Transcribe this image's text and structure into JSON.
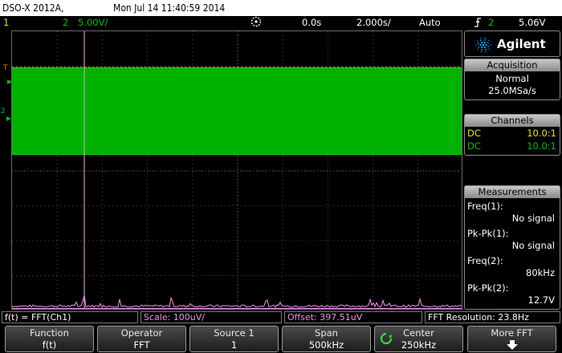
{
  "title_bar": {
    "model": "DSO-X 2012A,",
    "datetime": "Mon Jul 14 11:40:59 2014"
  },
  "status_row": {
    "ch1_num": "1",
    "ch2_num": "2",
    "ch2_scale": "5.00V/",
    "time_delay": "0.0s",
    "time_base": "2.000s/",
    "trigger_mode": "Auto",
    "trigger_channel": "2",
    "trigger_level": "5.06V"
  },
  "colors": {
    "ch1": "#e4e400",
    "ch2": "#00c000",
    "fft": "#f090f0",
    "accent": "#00b0ff"
  },
  "brand": {
    "name": "Agilent"
  },
  "acquisition": {
    "title": "Acquisition",
    "mode": "Normal",
    "rate": "25.0MSa/s"
  },
  "channels": {
    "title": "Channels",
    "rows": [
      {
        "coupling": "DC",
        "probe": "10.0:1",
        "color": "#e4e400"
      },
      {
        "coupling": "DC",
        "probe": "10.0:1",
        "color": "#00c000"
      }
    ]
  },
  "measurements": {
    "title": "Measurements",
    "items": [
      {
        "label": "Freq(1):",
        "value": "No signal",
        "color": "#e4e400"
      },
      {
        "label": "Pk-Pk(1):",
        "value": "No signal",
        "color": "#e4e400"
      },
      {
        "label": "Freq(2):",
        "value": "80kHz",
        "color": "#00c000"
      },
      {
        "label": "Pk-Pk(2):",
        "value": "12.7V",
        "color": "#00c000"
      }
    ]
  },
  "info_strip": {
    "function": "f(t) = FFT(Ch1)",
    "scale": "Scale: 100uV/",
    "offset": "Offset: 397.51uV",
    "resolution": "FFT Resolution: 23.8Hz"
  },
  "softkeys": [
    {
      "line1": "Function",
      "line2": "f(t)"
    },
    {
      "line1": "Operator",
      "line2": "FFT"
    },
    {
      "line1": "Source 1",
      "line2": "1"
    },
    {
      "line1": "Span",
      "line2": "500kHz"
    },
    {
      "line1": "Center",
      "line2": "250kHz"
    },
    {
      "line1": "More FFT",
      "line2": ""
    }
  ],
  "markers": {
    "ground_ch2": "2",
    "trigger": "T"
  }
}
